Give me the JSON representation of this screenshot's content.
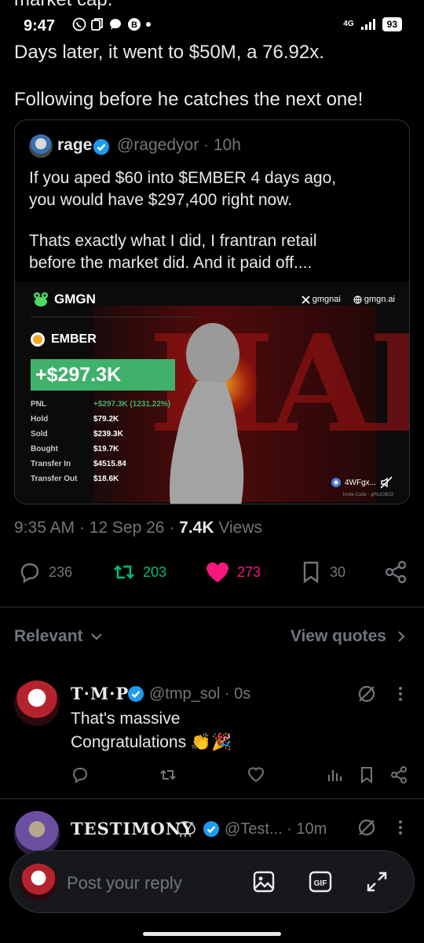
{
  "status_bar": {
    "time": "9:47",
    "network": "4G",
    "battery": "93"
  },
  "tweet": {
    "clipped_line": "market cap.",
    "line1": "Days later, it went to $50M, a 76.92x.",
    "line2": "Following before he catches the next one!",
    "meta_time": "9:35 AM",
    "meta_date": "12 Sep 26",
    "meta_views_count": "7.4K",
    "meta_views_label": "Views",
    "stats": {
      "replies": "236",
      "reposts": "203",
      "likes": "273",
      "bookmarks": "30"
    }
  },
  "quote": {
    "name": "rage",
    "handle": "@ragedyor · 10h",
    "line1": "If you aped $60 into $EMBER 4 days ago,",
    "line2": "you would have $297,400 right now.",
    "line3": "Thats exactly what I did, I frantran retail",
    "line4": "before the market did. And it paid off...."
  },
  "pnl_card": {
    "brand": "GMGN",
    "link_x": "gmgnai",
    "link_web": "gmgn.ai",
    "token": "EMBER",
    "amount": "+$297.3K",
    "rows": [
      {
        "k": "PNL",
        "v": "+$297.3K (1231.22%)"
      },
      {
        "k": "Hold",
        "v": "$79.2K"
      },
      {
        "k": "Sold",
        "v": "$239.3K"
      },
      {
        "k": "Bought",
        "v": "$19.7K"
      },
      {
        "k": "Transfer In",
        "v": "$4515.84"
      },
      {
        "k": "Transfer Out",
        "v": "$18.6K"
      }
    ],
    "address": "4WFgx...",
    "invite": "Invite Code : qPb1GBJ3",
    "watermark": "HADZ"
  },
  "replies_header": {
    "sort_label": "Relevant",
    "view_quotes": "View quotes"
  },
  "replies": [
    {
      "name": "T·M·P",
      "handle": "@tmp_sol · 0s",
      "line1": "That's massive",
      "line2": "Congratulations 👏🎉"
    },
    {
      "name": "TESTIMONY",
      "handle": "@Test... · 10m"
    }
  ],
  "composer": {
    "placeholder": "Post your reply"
  }
}
